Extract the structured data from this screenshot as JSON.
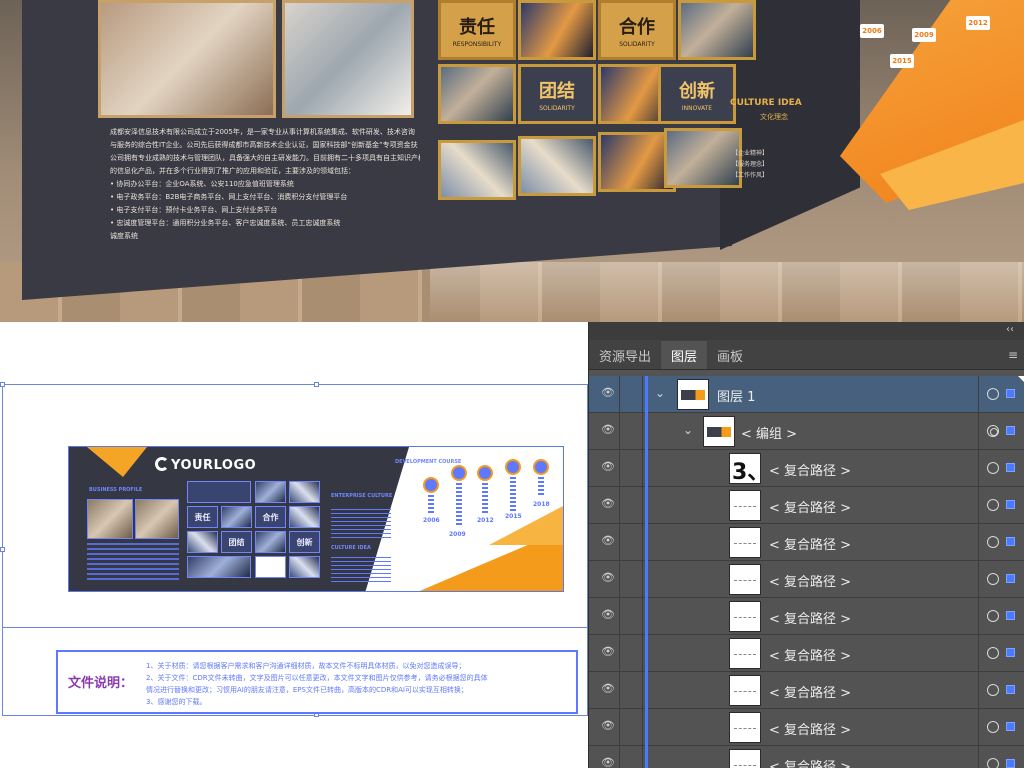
{
  "render": {
    "values": [
      {
        "cn": "责任",
        "en": "RESPONSIBILITY"
      },
      {
        "cn": "合作",
        "en": "SOLIDARITY"
      },
      {
        "cn": "团结",
        "en": "SOLIDARITY"
      },
      {
        "cn": "创新",
        "en": "INNOVATE"
      }
    ],
    "culture_title": "CULTURE IDEA",
    "culture_sub": "文化理念",
    "culture_lines": [
      "【企业精神】",
      "【服务理念】",
      "【工作作风】"
    ],
    "years": [
      "2006",
      "2009",
      "2012",
      "2015"
    ],
    "description": [
      "成都安泽信息技术有限公司成立于2005年，是一家专业从事计算机系统集成、软件研发、技术咨询",
      "与服务的综合性IT企业。公司先后获得成都市高新技术企业认证，国家科技部“创新基金”专项资金扶",
      "公司拥有专业成熟的技术与管理团队，具备强大的自主研发能力。目前拥有二十多项具有自主知识产权",
      "的信息化产品，并在多个行业得到了推广的应用和验证，主要涉及的领域包括：",
      "• 协同办公平台：企业OA系统、公安110应急值班管理系统",
      "• 电子政务平台：B2B电子商务平台、网上支付平台、消费积分支付管理平台",
      "• 电子支付平台：预付卡业务平台、网上支付业务平台",
      "• 忠诚度管理平台：通用积分业务平台、客户忠诚度系统、员工忠诚度系统",
      "诚度系统"
    ]
  },
  "artboard": {
    "logo": "YOURLOGO",
    "labels": {
      "business_profile": "BUSINESS PROFILE",
      "dev_course": "DEVELOPMENT COURSE",
      "enterprise_culture": "ENTERPRISE CULTURE",
      "culture_idea": "CULTURE IDEA"
    },
    "grid_words": [
      "责任",
      "合作",
      "团结",
      "创新"
    ],
    "years": [
      "2006",
      "2009",
      "2012",
      "2015",
      "2018"
    ]
  },
  "note": {
    "title": "文件说明：",
    "lines": [
      "1、关于材质：请您根据客户需求和客户沟通详细材质，故本文件不标明具体材质，以免对您造成误导；",
      "2、关于文件：CDR文件未转曲，文字及图片可以任意更改，本文件文字和图片仅供参考，请务必根据您的具体",
      "    情况进行替换和更改；习惯用AI的朋友请注意，EPS文件已转曲，高版本的CDR和AI可以实现互相转换；",
      "3、感谢您的下载。"
    ]
  },
  "panel": {
    "tabs": [
      "资源导出",
      "图层",
      "画板"
    ],
    "active_tab": "图层",
    "collapse": "‹‹",
    "menu": "≡",
    "layer_row": {
      "label": "图层 1"
    },
    "group_row": {
      "label": "< 编组 >"
    },
    "path_rows": [
      {
        "label": "< 复合路径 >",
        "thumb": "3、"
      },
      {
        "label": "< 复合路径 >",
        "thumb": ""
      },
      {
        "label": "< 复合路径 >",
        "thumb": ""
      },
      {
        "label": "< 复合路径 >",
        "thumb": ""
      },
      {
        "label": "< 复合路径 >",
        "thumb": ""
      },
      {
        "label": "< 复合路径 >",
        "thumb": ""
      },
      {
        "label": "< 复合路径 >",
        "thumb": ""
      },
      {
        "label": "< 复合路径 >",
        "thumb": ""
      },
      {
        "label": "< 复合路径 >",
        "thumb": ""
      }
    ],
    "icons": {
      "visibility": "eye-icon",
      "expand": "chevron-down-icon",
      "target": "target-icon"
    },
    "colors": {
      "selection": "#4a7bff",
      "selected_row": "#46607d",
      "panel_bg": "#535353"
    }
  },
  "colors": {
    "orange": "#f49b1c",
    "dark": "#353742",
    "blue": "#5e78ff"
  }
}
